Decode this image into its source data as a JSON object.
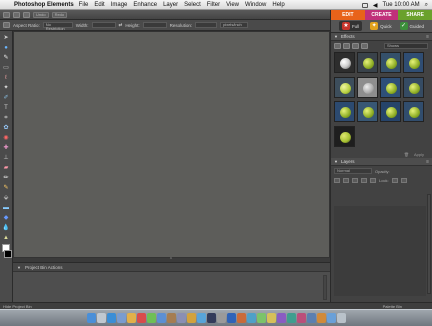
{
  "menubar": {
    "app_name": "Photoshop Elements",
    "items": [
      "File",
      "Edit",
      "Image",
      "Enhance",
      "Layer",
      "Select",
      "Filter",
      "View",
      "Window",
      "Help"
    ],
    "clock": "Tue 10:00 AM"
  },
  "toolbar": {
    "undo_label": "Undo",
    "redo_label": "Redo"
  },
  "options": {
    "aspect_label": "Aspect Ratio:",
    "aspect_value": "No Restriction",
    "width_label": "Width:",
    "height_label": "Height:",
    "resolution_label": "Resolution:",
    "resolution_unit": "pixels/inch"
  },
  "mode_tabs": [
    {
      "label": "EDIT",
      "color": "#e8631a"
    },
    {
      "label": "CREATE",
      "color": "#c0307a"
    },
    {
      "label": "SHARE",
      "color": "#6aa12c"
    }
  ],
  "subtabs": [
    {
      "label": "Full"
    },
    {
      "label": "Quick"
    },
    {
      "label": "Guided"
    }
  ],
  "effects": {
    "title": "Effects",
    "filter_dropdown": "Shows",
    "apply_label": "Apply"
  },
  "layers": {
    "title": "Layers",
    "blend_mode": "Normal",
    "opacity_label": "Opacity:",
    "lock_label": "Lock:"
  },
  "project_bin": {
    "title": "Project Bin Actions"
  },
  "statusbar": {
    "left": "Hide Project Bin",
    "right": "Palette Bin"
  }
}
